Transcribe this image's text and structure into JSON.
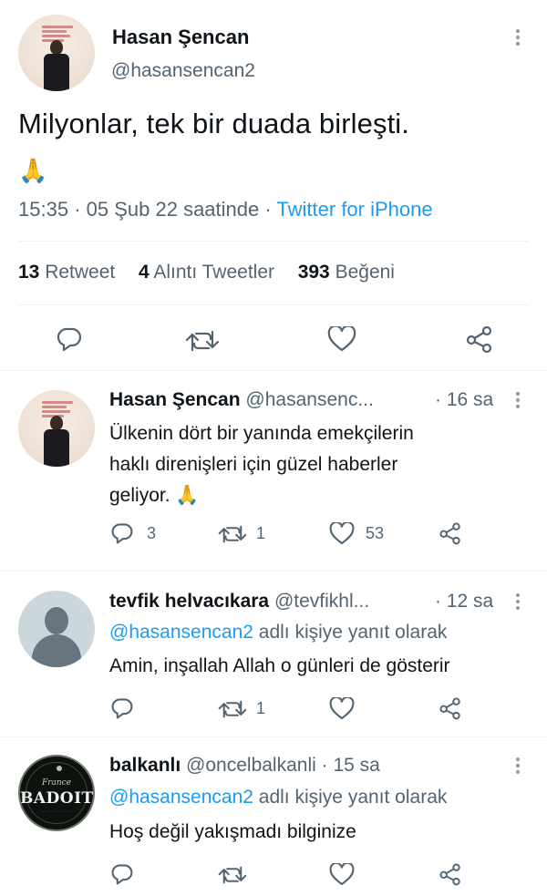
{
  "main_tweet": {
    "author_name": "Hasan Şencan",
    "author_handle": "@hasansencan2",
    "text": "Milyonlar, tek bir duada birleşti.",
    "emoji": "🙏",
    "time": "15:35",
    "sep1": "·",
    "date": "05 Şub 22 saatinde",
    "sep2": "·",
    "source": "Twitter for iPhone",
    "retweet_count": "13",
    "retweet_label": "Retweet",
    "quote_count": "4",
    "quote_label": "Alıntı Tweetler",
    "like_count": "393",
    "like_label": "Beğeni"
  },
  "replies": [
    {
      "author_name": "Hasan Şencan",
      "author_handle": "@hasansenc...",
      "age": "· 16 sa",
      "text_line1": "Ülkenin dört bir yanında emekçilerin",
      "text_line2": "haklı direnişleri için güzel haberler",
      "text_line3": "geliyor.",
      "emoji": "🙏",
      "reply_count": "3",
      "retweet_count": "1",
      "like_count": "53"
    },
    {
      "author_name": "tevfik helvacıkara",
      "author_handle": "@tevfikhl...",
      "age": "· 12 sa",
      "reply_to_handle": "@hasansencan2",
      "reply_to_suffix": "adlı kişiye yanıt olarak",
      "text_line1": "Amin, inşallah Allah o günleri de gösterir",
      "retweet_count": "1"
    },
    {
      "author_name": "balkanlı",
      "author_handle": "@oncelbalkanli",
      "age": "· 15 sa",
      "reply_to_handle": "@hasansencan2",
      "reply_to_suffix": "adlı kişiye yanıt olarak",
      "text_line1": "Hoş değil yakışmadı bilginize",
      "avatar_text": "BADOIT",
      "avatar_script": "France"
    }
  ],
  "colors": {
    "text": "#0f1419",
    "secondary": "#536471",
    "link": "#1d9bf0",
    "divider": "#eff3f4"
  },
  "icons": [
    "reply-icon",
    "retweet-icon",
    "like-icon",
    "share-icon",
    "more-icon",
    "pray-emoji"
  ]
}
